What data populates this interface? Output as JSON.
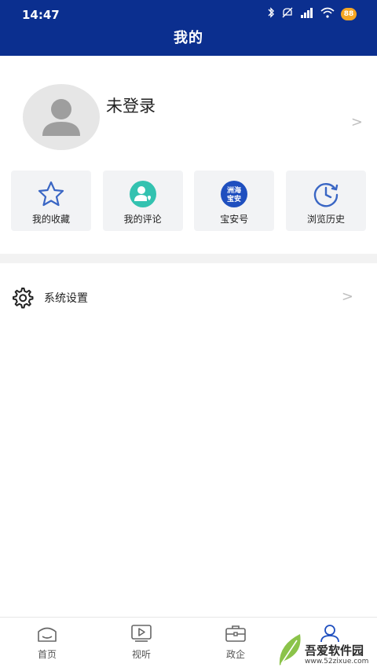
{
  "status_bar": {
    "time": "14:47",
    "icons": [
      "bluetooth-icon",
      "mute-icon",
      "signal-icon",
      "wifi-icon"
    ],
    "battery": "88"
  },
  "header": {
    "title": "我的",
    "background": "#0b2f8f"
  },
  "profile": {
    "login_label": "未登录",
    "arrow": ">"
  },
  "tiles": [
    {
      "label": "我的收藏",
      "icon": "star-icon"
    },
    {
      "label": "我的评论",
      "icon": "comment-user-icon"
    },
    {
      "label": "宝安号",
      "icon": "baoan-logo-icon",
      "logo_text_1": "洲海",
      "logo_text_2": "宝安"
    },
    {
      "label": "浏览历史",
      "icon": "history-clock-icon"
    }
  ],
  "settings": {
    "label": "系统设置",
    "arrow": ">"
  },
  "bottom_nav": [
    {
      "label": "首页",
      "icon": "home-icon"
    },
    {
      "label": "视听",
      "icon": "video-play-icon"
    },
    {
      "label": "政企",
      "icon": "briefcase-icon"
    }
  ],
  "watermark": {
    "brand": "吾爱软件园",
    "url": "www.52zixue.com"
  }
}
